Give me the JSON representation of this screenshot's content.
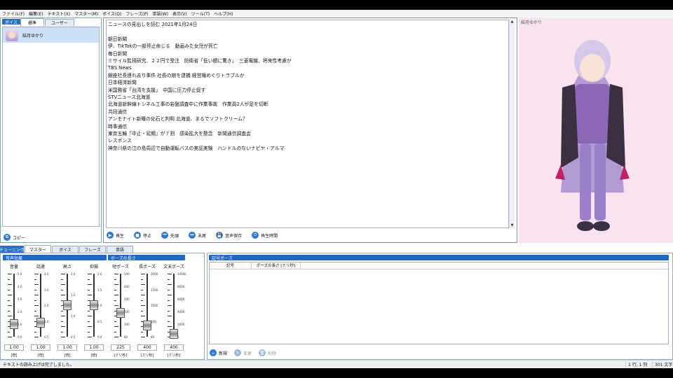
{
  "menu": [
    "ファイル(F)",
    "編集(E)",
    "テキスト(X)",
    "マスター(M)",
    "ボイス(O)",
    "フレーズ(P)",
    "単語(W)",
    "表示(V)",
    "ツール(T)",
    "ヘルプ(H)"
  ],
  "voice_panel": {
    "tabs": [
      "ボイス",
      "標準",
      "ユーザー"
    ],
    "selected_voice": "結月ゆかり",
    "copy_label": "コピー"
  },
  "editor": {
    "lines": [
      "ニュースの見出しを読む 2021年1月24日",
      "",
      "朝日新聞",
      "伊、TikTokの一部停止命じる　動画みた女児が死亡",
      "毎日新聞",
      "ミサイル監視研究、２２円で受注　防衛省「低い額に驚き」　三菱電機、将来性考慮か",
      "TBS News",
      "銀座社長連れ去り事件 社長の娘を逮捕 経営権めぐりトラブルか",
      "日本経済新聞",
      "米国務省「台湾を支援」　中国に圧力停止促す",
      "STVニュース北海道",
      "北海道新幹線トンネル工事の岩盤調査中に作業事故　作業員2人が足を切断",
      "共同通信",
      "アンモナイト新種の化石と判明 北海道、まるでソフトクリーム？",
      "時事通信",
      "東京五輪「中止・延期」が７割　感染拡大を懸念　新聞通信調査会",
      "レスポンス",
      "神奈川県の江の島周辺で自動運転バスの実証実験　ハンドルのないナビヤ・アルマ"
    ],
    "buttons": [
      "再生",
      "停止",
      "先頭",
      "末尾",
      "音声保存",
      "再生時間"
    ]
  },
  "character": {
    "name": "結月ゆかり"
  },
  "tuning": {
    "tabs": [
      "チューニング",
      "マスター",
      "ボイス",
      "フレーズ",
      "単語"
    ],
    "effects_title": "音声効果",
    "pause_title": "ポーズの長さ",
    "sliders": [
      {
        "label": "音量",
        "value": "1.00",
        "unit": "[倍]",
        "level": 0.2,
        "ticks": [
          "5.0",
          "4.0",
          "3.0",
          "2.0",
          "1.0",
          "0.0"
        ]
      },
      {
        "label": "話速",
        "value": "1.00",
        "unit": "[倍]",
        "level": 0.22,
        "ticks": [
          "4.0",
          "3.0",
          "2.0",
          "1.0",
          "0.5"
        ]
      },
      {
        "label": "高さ",
        "value": "1.00",
        "unit": "[倍]",
        "level": 0.5,
        "ticks": [
          "2.0",
          "1.5",
          "1.0",
          "0.5"
        ]
      },
      {
        "label": "抑揚",
        "value": "1.00",
        "unit": "[倍]",
        "level": 0.5,
        "ticks": [
          "2.0",
          "1.5",
          "1.0",
          "0.5",
          "0.0"
        ]
      },
      {
        "label": "短ポーズ",
        "value": "225",
        "unit": "[ミリ秒]",
        "level": 0.38,
        "ticks": [
          "500",
          "400",
          "300",
          "200",
          "100",
          "80"
        ]
      },
      {
        "label": "長ポーズ",
        "value": "400",
        "unit": "[ミリ秒]",
        "level": 0.18,
        "ticks": [
          "2000",
          "1500",
          "1000",
          "500",
          "80"
        ]
      },
      {
        "label": "文末ポーズ",
        "value": "400",
        "unit": "[ミリ秒]",
        "level": 0.04,
        "ticks": [
          "10000",
          "8000",
          "6000",
          "4000",
          "2000",
          "0"
        ]
      }
    ]
  },
  "symbol_pause": {
    "title": "記号ポーズ",
    "columns": [
      "記号",
      "ポーズの長さ [ミリ秒]"
    ],
    "buttons": [
      "新規",
      "変更",
      "削除"
    ]
  },
  "status": {
    "message": "テキストの読み上げは完了しました。",
    "position": "1 行, 1 列",
    "chars": "301 文字"
  },
  "colors": {
    "accent": "#1f66c9",
    "character_bg": "#f7e4f0"
  }
}
